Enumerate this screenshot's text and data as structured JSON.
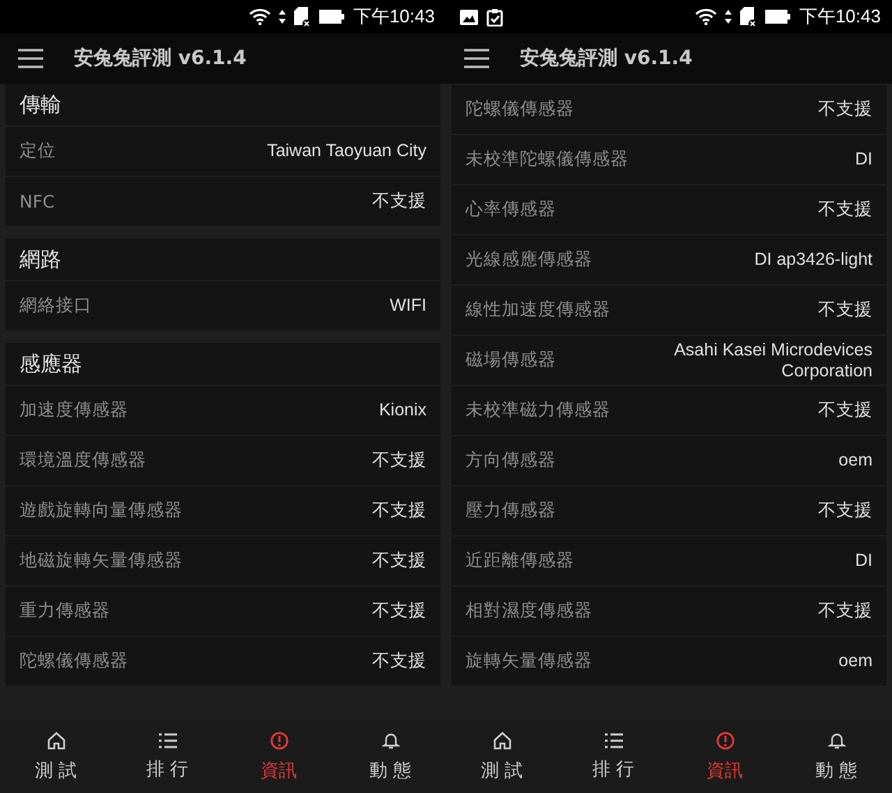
{
  "phones": [
    {
      "status_bar": {
        "time": "下午10:43"
      },
      "title": "安兔兔評測 v6.1.4",
      "sections": [
        {
          "heading": "傳輸",
          "rows": [
            {
              "label": "定位",
              "value": "Taiwan Taoyuan City"
            },
            {
              "label": "NFC",
              "value": "不支援"
            }
          ]
        },
        {
          "heading": "網路",
          "rows": [
            {
              "label": "網絡接口",
              "value": "WIFI"
            }
          ]
        },
        {
          "heading": "感應器",
          "rows": [
            {
              "label": "加速度傳感器",
              "value": "Kionix"
            },
            {
              "label": "環境溫度傳感器",
              "value": "不支援"
            },
            {
              "label": "遊戲旋轉向量傳感器",
              "value": "不支援"
            },
            {
              "label": "地磁旋轉矢量傳感器",
              "value": "不支援"
            },
            {
              "label": "重力傳感器",
              "value": "不支援"
            },
            {
              "label": "陀螺儀傳感器",
              "value": "不支援"
            }
          ]
        }
      ],
      "nav": [
        {
          "label": "測 試",
          "selected": false
        },
        {
          "label": "排 行",
          "selected": false
        },
        {
          "label": "資訊",
          "selected": true
        },
        {
          "label": "動 態",
          "selected": false
        }
      ]
    },
    {
      "status_bar": {
        "notifications": [
          {
            "kind": "image"
          },
          {
            "kind": "clipboard"
          }
        ],
        "time": "下午10:43"
      },
      "title": "安兔兔評測 v6.1.4",
      "sections": [
        {
          "rows": [
            {
              "label": "陀螺儀傳感器",
              "value": "不支援"
            },
            {
              "label": "未校準陀螺儀傳感器",
              "value": "DI"
            },
            {
              "label": "心率傳感器",
              "value": "不支援"
            },
            {
              "label": "光線感應傳感器",
              "value": "DI ap3426-light"
            },
            {
              "label": "線性加速度傳感器",
              "value": "不支援"
            },
            {
              "label": "磁場傳感器",
              "value": "Asahi Kasei Microdevices Corporation"
            },
            {
              "label": "未校準磁力傳感器",
              "value": "不支援"
            },
            {
              "label": "方向傳感器",
              "value": "oem"
            },
            {
              "label": "壓力傳感器",
              "value": "不支援"
            },
            {
              "label": "近距離傳感器",
              "value": "DI"
            },
            {
              "label": "相對濕度傳感器",
              "value": "不支援"
            },
            {
              "label": "旋轉矢量傳感器",
              "value": "oem"
            }
          ]
        }
      ],
      "nav": [
        {
          "label": "測 試",
          "selected": false
        },
        {
          "label": "排 行",
          "selected": false
        },
        {
          "label": "資訊",
          "selected": true
        },
        {
          "label": "動 態",
          "selected": false
        }
      ]
    }
  ]
}
